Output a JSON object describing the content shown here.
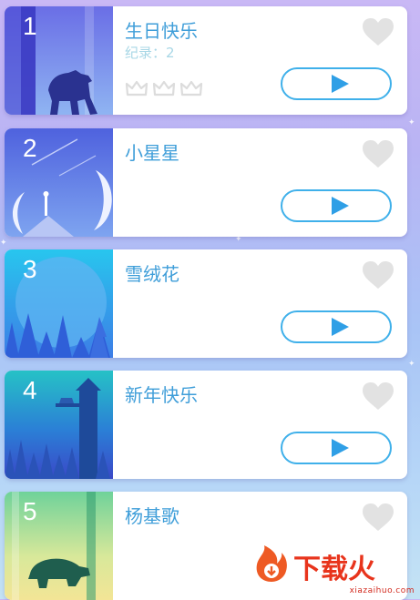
{
  "songs": [
    {
      "number": "1",
      "title": "生日快乐",
      "record": "纪录：2",
      "crowns": 3,
      "favorited": false,
      "play": "play-icon"
    },
    {
      "number": "2",
      "title": "小星星",
      "favorited": false,
      "play": "play-icon"
    },
    {
      "number": "3",
      "title": "雪绒花",
      "favorited": false,
      "play": "play-icon"
    },
    {
      "number": "4",
      "title": "新年快乐",
      "favorited": false,
      "play": "play-icon"
    },
    {
      "number": "5",
      "title": "杨基歌",
      "favorited": false,
      "play": "play-icon"
    }
  ],
  "watermark": {
    "brand": "下载火",
    "url": "xiazaihuo.com"
  },
  "colors": {
    "accent": "#3fb0ea",
    "title": "#3f9ed9",
    "record": "#a8d7e6",
    "heart": "#e2e2e2",
    "crown": "#dcdcdc",
    "watermark": "#e8341c"
  }
}
